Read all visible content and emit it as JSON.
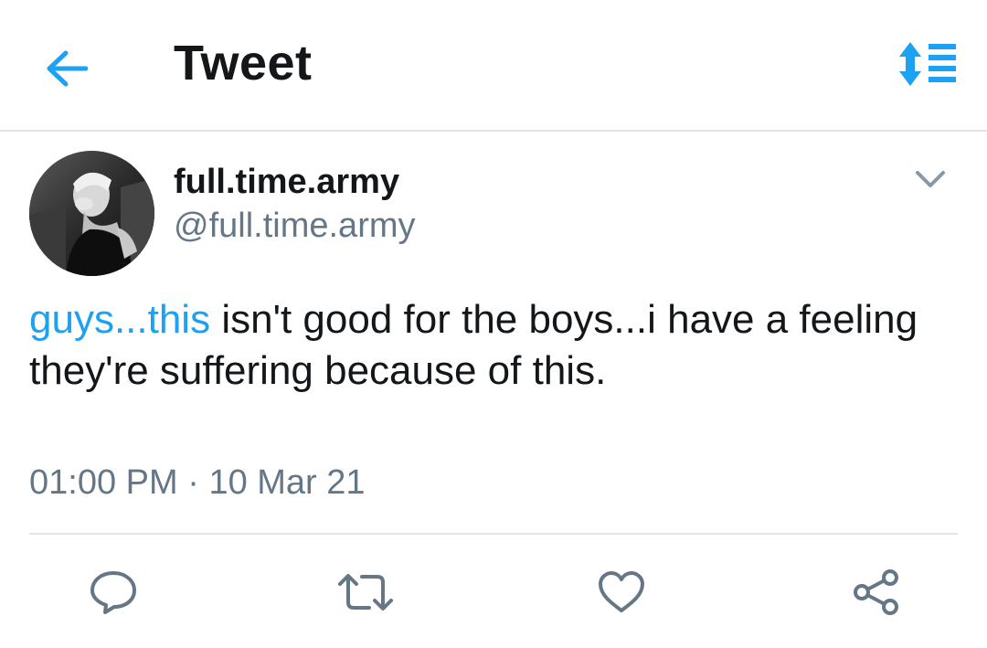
{
  "header": {
    "title": "Tweet",
    "back_icon": "back-arrow-icon",
    "sort_icon": "sort-list-icon",
    "accent_color": "#1da1f2"
  },
  "tweet": {
    "display_name": "full.time.army",
    "handle": "@full.time.army",
    "text_link": "guys...this",
    "text_rest": " isn't good for the boys...i have a feeling they're suffering because of this.",
    "time": "01:00 PM",
    "separator": " · ",
    "date": "10 Mar 21"
  },
  "actions": [
    {
      "name": "reply",
      "icon": "reply-icon"
    },
    {
      "name": "retweet",
      "icon": "retweet-icon"
    },
    {
      "name": "like",
      "icon": "heart-icon"
    },
    {
      "name": "share",
      "icon": "share-icon"
    }
  ],
  "colors": {
    "text": "#14171a",
    "secondary": "#657786",
    "divider": "#e1e4e6",
    "link": "#1da1f2"
  }
}
